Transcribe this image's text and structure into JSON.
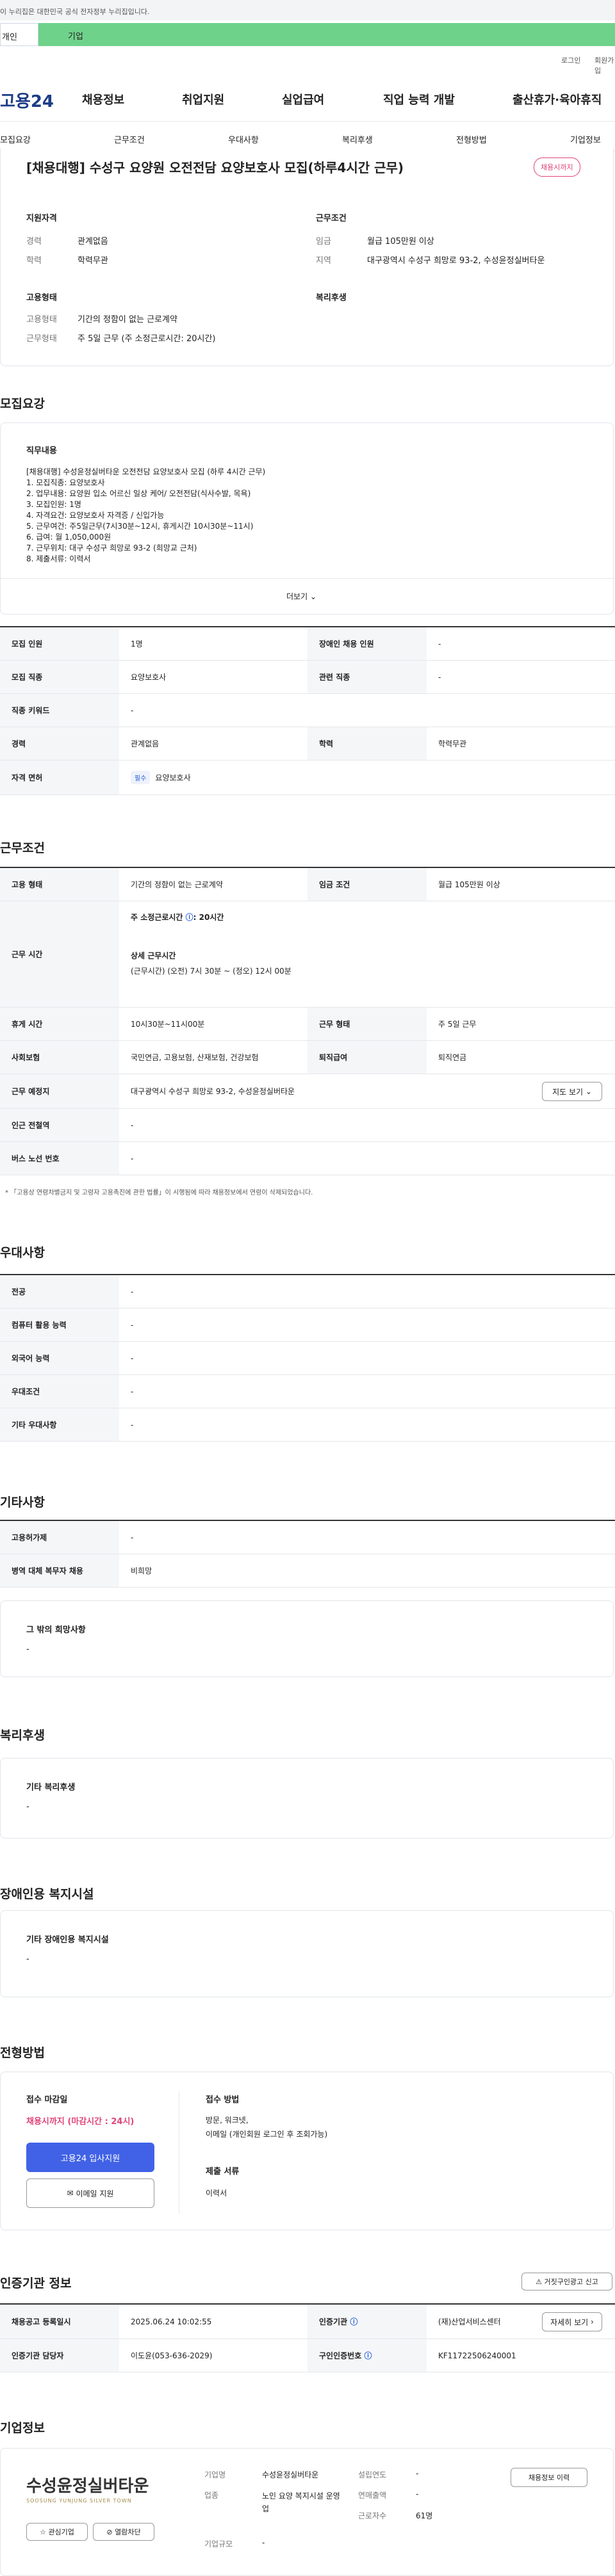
{
  "topbar": {
    "notice": "이 누리집은 대한민국 공식 전자정부 누리집입니다."
  },
  "tabs": {
    "person": "개인",
    "biz": "기업"
  },
  "util": {
    "login": "로그인",
    "join": "회원가입"
  },
  "gnb": {
    "logo": "고용24",
    "items": [
      "채용정보",
      "취업지원",
      "실업급여",
      "직업 능력 개발",
      "출산휴가·육아휴직"
    ]
  },
  "subnav": [
    "모집요강",
    "근무조건",
    "우대사항",
    "복리후생",
    "전형방법",
    "기업정보"
  ],
  "job": {
    "title": "[채용대행] 수성구 요양원 오전전담 요양보호사 모집(하루4시간 근무)",
    "badge": "채용시까지",
    "qual_title": "지원자격",
    "cond_title": "근무조건",
    "career_l": "경력",
    "career_v": "관계없음",
    "edu_l": "학력",
    "edu_v": "학력무관",
    "pay_l": "임금",
    "pay_v": "월급 105만원 이상",
    "loc_l": "지역",
    "loc_v": "대구광역시 수성구 희망로 93-2, 수성윤정실버타운",
    "emp_title": "고용형태",
    "welfare_title": "복리후생",
    "emptype_l": "고용형태",
    "emptype_v": "기간의 정함이 없는 근로계약",
    "worktype_l": "근무형태",
    "worktype_v": "주 5일 근무 (주 소정근로시간: 20시간)"
  },
  "recruit": {
    "section": "모집요강",
    "duty_title": "직무내용",
    "duty_lines": [
      "[채용대행] 수성윤정실버타운 오전전담 요양보호사 모집 (하루 4시간 근무)",
      "1. 모집직종: 요양보호사",
      "2. 업무내용: 요양원 입소 어르신 일상 케어/ 오전전담(식사수발, 목욕)",
      "3. 모집인원: 1명",
      "4. 자격요건: 요양보호사 자격증 / 신입가능",
      "5. 근무여건: 주5일근무(7시30분~12시, 휴게시간 10시30분~11시)",
      "6. 급여: 월 1,050,000원",
      "7. 근무위치: 대구 수성구 희망로 93-2 (희망교 근처)",
      "8. 제출서류: 이력서"
    ],
    "more": "더보기",
    "rows": [
      [
        "모집 인원",
        "1명",
        "장애인 채용 인원",
        "-"
      ],
      [
        "모집 직종",
        "요양보호사",
        "관련 직종",
        "-"
      ],
      [
        "직종 키워드",
        "-"
      ],
      [
        "경력",
        "관계없음",
        "학력",
        "학력무관"
      ]
    ],
    "license_l": "자격 면허",
    "license_tag": "필수",
    "license_v": "요양보호사"
  },
  "work": {
    "section": "근무조건",
    "r1": [
      "고용 형태",
      "기간의 정함이 없는 근로계약",
      "임금 조건",
      "월급 105만원 이상"
    ],
    "time_l": "근무 시간",
    "time_title": "주 소정근로시간",
    "time_val": ": 20시간",
    "time_detail_t": "상세 근무시간",
    "time_detail": "(근무시간) (오전) 7시 30분 ~ (정오) 12시 00분",
    "r3": [
      "휴게 시간",
      "10시30분~11시00분",
      "근무 형태",
      "주 5일 근무"
    ],
    "r4": [
      "사회보험",
      "국민연금, 고용보험, 산재보험, 건강보험",
      "퇴직급여",
      "퇴직연금"
    ],
    "r5": [
      "근무 예정지",
      "대구광역시 수성구 희망로 93-2, 수성윤정실버타운"
    ],
    "map_btn": "지도 보기",
    "r6": [
      "인근 전철역",
      "-"
    ],
    "r7": [
      "버스 노선 번호",
      "-"
    ],
    "note": "* 「고용상 연령차별금지 및 고령자 고용촉진에 관한 법률」이 시행됨에 따라 채용정보에서 연령이 삭제되었습니다."
  },
  "pref": {
    "section": "우대사항",
    "rows": [
      [
        "전공",
        "-"
      ],
      [
        "컴퓨터 활용 능력",
        "-"
      ],
      [
        "외국어 능력",
        "-"
      ],
      [
        "우대조건",
        "-"
      ],
      [
        "기타 우대사항",
        "-"
      ]
    ]
  },
  "etc": {
    "section": "기타사항",
    "rows": [
      [
        "고용허가제",
        "-"
      ],
      [
        "병역 대체 복무자 채용",
        "비희망"
      ]
    ],
    "other_t": "그 밖의 희망사항",
    "other_v": "-"
  },
  "welfare": {
    "section": "복리후생",
    "t": "기타 복리후생",
    "v": "-"
  },
  "disabled": {
    "section": "장애인용 복지시설",
    "t": "기타 장애인용 복지시설",
    "v": "-"
  },
  "apply": {
    "section": "전형방법",
    "deadline_t": "접수 마감일",
    "deadline_v": "채용시까지 (마감시간 : 24시)",
    "apply_btn": "고용24 입사지원",
    "email_btn": "이메일 지원",
    "method_t": "접수 방법",
    "method_v1": "방문, 워크넷,",
    "method_v2": "이메일 (개인회원 로그인 후 조회가능)",
    "docs_t": "제출 서류",
    "docs_v": "이력서"
  },
  "cert": {
    "section": "인증기관 정보",
    "report_btn": "거짓구인광고 신고",
    "r1": [
      "채용공고 등록일시",
      "2025.06.24 10:02:55",
      "인증기관",
      "(재)산업서비스센터"
    ],
    "detail_btn": "자세히 보기",
    "r2": [
      "인증기관 담당자",
      "이도윤(053-636-2029)",
      "구인인증번호",
      "KF11722506240001"
    ]
  },
  "company": {
    "section": "기업정보",
    "logo_kr": "수성윤정실버타운",
    "logo_en": "SOOSUNG YUNJUNG SILVER TOWN",
    "fav_btn": "관심기업",
    "block_btn": "열람차단",
    "name_l": "기업명",
    "name_v": "수성윤정실버타운",
    "ind_l": "업종",
    "ind_v": "노인 요양 복지시설 운영업",
    "year_l": "설립연도",
    "year_v": "-",
    "sales_l": "연매출액",
    "sales_v": "-",
    "emp_l": "근로자수",
    "emp_v": "61명",
    "scale_l": "기업규모",
    "scale_v": "-",
    "info_btn": "채용정보 이력"
  }
}
